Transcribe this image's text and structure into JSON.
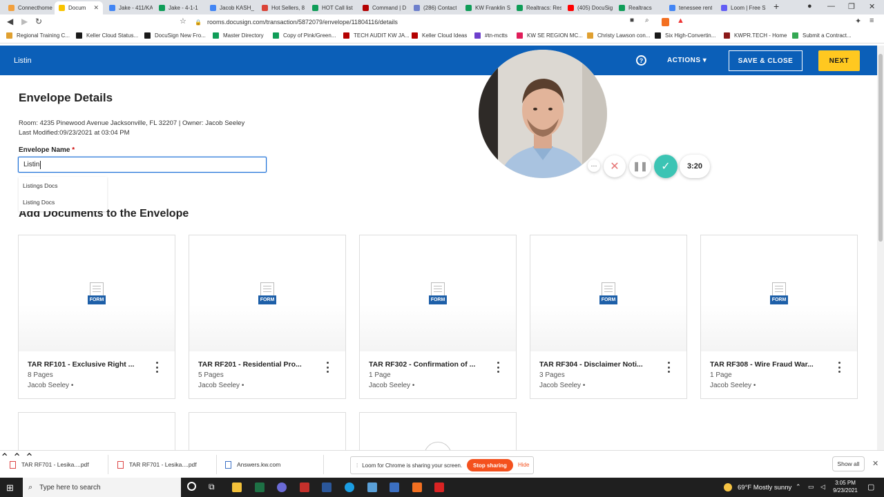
{
  "browser": {
    "tabs": [
      {
        "label": "Connecthome",
        "color": "#f2a03d"
      },
      {
        "label": "Docum",
        "color": "#f9c400",
        "active": true
      },
      {
        "label": "Jake - 411/KA",
        "color": "#4285f4"
      },
      {
        "label": "Jake - 4-1-1",
        "color": "#0f9d58"
      },
      {
        "label": "Jacob KASH_",
        "color": "#4285f4"
      },
      {
        "label": "Hot Sellers, 8",
        "color": "#db4437"
      },
      {
        "label": "HOT Call list",
        "color": "#0f9d58"
      },
      {
        "label": "Command | D",
        "color": "#b40101"
      },
      {
        "label": "(286) Contact",
        "color": "#6d7fcc"
      },
      {
        "label": "KW Franklin S",
        "color": "#0f9d58"
      },
      {
        "label": "Realtracs: Res",
        "color": "#0f9d58"
      },
      {
        "label": "(405) DocuSig",
        "color": "#ff0000"
      },
      {
        "label": "Realtracs",
        "color": "#0f9d58"
      },
      {
        "label": "tenessee rent",
        "color": "#4285f4"
      },
      {
        "label": "Loom | Free S",
        "color": "#625df5"
      }
    ],
    "url": "rooms.docusign.com/transaction/5872079/envelope/11804116/details",
    "bookmarks": [
      {
        "label": "Regional Training C...",
        "color": "#e0a030"
      },
      {
        "label": "Keller Cloud Status...",
        "color": "#1a1a1a"
      },
      {
        "label": "DocuSign New Fro...",
        "color": "#1a1a1a"
      },
      {
        "label": "Master Directory",
        "color": "#0f9d58"
      },
      {
        "label": "Copy of Pink/Green...",
        "color": "#0f9d58"
      },
      {
        "label": "TECH AUDIT KW JA...",
        "color": "#b40101"
      },
      {
        "label": "Keller Cloud Ideas",
        "color": "#b40101"
      },
      {
        "label": "#tn-mctts",
        "color": "#6d3fcc"
      },
      {
        "label": "KW SE REGION MC...",
        "color": "#e01e5a"
      },
      {
        "label": "Christy Lawson con...",
        "color": "#e0a030"
      },
      {
        "label": "Six High-Convertin...",
        "color": "#1a1a1a"
      },
      {
        "label": "KWPR.TECH - Home",
        "color": "#8b1a1a"
      },
      {
        "label": "Submit a Contract...",
        "color": "#34a853"
      }
    ]
  },
  "header": {
    "title": "Listin",
    "help_label": "?",
    "actions_label": "ACTIONS ▾",
    "save_close_label": "SAVE & CLOSE",
    "next_label": "NEXT"
  },
  "envelope": {
    "heading": "Envelope Details",
    "room_line": "Room: 4235 Pinewood Avenue Jacksonville, FL 32207 | Owner: Jacob Seeley",
    "modified_line": "Last Modified:09/23/2021 at 03:04 PM",
    "name_label": "Envelope Name",
    "required_mark": "*",
    "name_value": "Listin",
    "suggestions": [
      "Listings Docs",
      "Listing Docs"
    ]
  },
  "documents": {
    "heading": "Add Documents to the Envelope",
    "form_badge": "FORM",
    "items": [
      {
        "title": "TAR RF101 - Exclusive Right ...",
        "pages": "8 Pages",
        "owner": "Jacob Seeley •"
      },
      {
        "title": "TAR RF201 - Residential Pro...",
        "pages": "5 Pages",
        "owner": "Jacob Seeley •"
      },
      {
        "title": "TAR RF302 - Confirmation of ...",
        "pages": "1 Page",
        "owner": "Jacob Seeley •"
      },
      {
        "title": "TAR RF304 - Disclaimer Noti...",
        "pages": "3 Pages",
        "owner": "Jacob Seeley •"
      },
      {
        "title": "TAR RF308 - Wire Fraud War...",
        "pages": "1 Page",
        "owner": "Jacob Seeley •"
      }
    ]
  },
  "loom": {
    "timer": "3:20",
    "sharing_text": "Loom for Chrome is sharing your screen.",
    "stop_label": "Stop sharing",
    "hide_label": "Hide"
  },
  "downloads": {
    "items": [
      "TAR RF701 - Lesika....pdf",
      "TAR RF701 - Lesika....pdf",
      "Answers.kw.com"
    ],
    "show_all": "Show all"
  },
  "taskbar": {
    "search_placeholder": "Type here to search",
    "weather": "69°F  Mostly sunny",
    "time": "3:05 PM",
    "date": "9/23/2021"
  },
  "colors": {
    "header_blue": "#0b5fb8",
    "next_yellow": "#ffc820",
    "confirm_teal": "#3cc4b4",
    "stop_orange": "#f4511e"
  }
}
